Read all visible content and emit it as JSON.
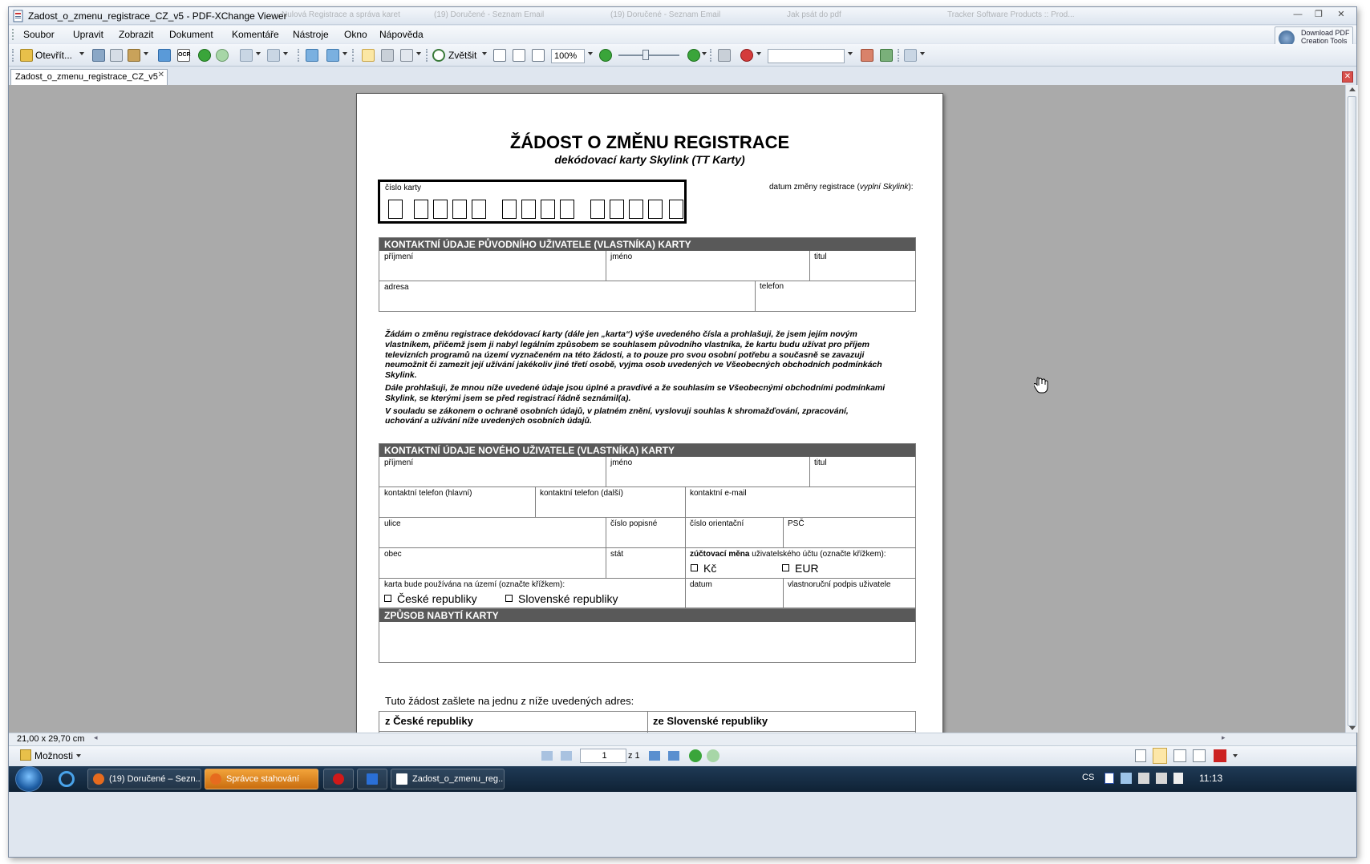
{
  "window": {
    "title": "Zadost_o_zmenu_registrace_CZ_v5 - PDF-XChange Viewer",
    "bg_tabs": [
      "Nulová Registrace a správa karet",
      "(19) Doručené - Seznam Email",
      "(19) Doručené - Seznam Email",
      "Jak psát do pdf",
      "Tracker Software Products :: Prod..."
    ]
  },
  "menu": [
    "Soubor",
    "Upravit",
    "Zobrazit",
    "Dokument",
    "Komentáře",
    "Nástroje",
    "Okno",
    "Nápověda"
  ],
  "download_pdf": {
    "line1": "Download PDF",
    "line2": "Creation Tools"
  },
  "toolbar": {
    "open_label": "Otevřít...",
    "zoom_in_label": "Zvětšit",
    "zoom_value": "100%",
    "ocr_label": "OCR",
    "search_value": ""
  },
  "tab": {
    "label": "Zadost_o_zmenu_registrace_CZ_v5"
  },
  "document": {
    "title": "ŽÁDOST O ZMĚNU REGISTRACE",
    "subtitle": "dekódovací karty Skylink (TT Karty)",
    "card_number_label": "číslo karty",
    "change_date_label_pre": "datum změny registrace (",
    "change_date_label_em": "vyplní Skylink",
    "change_date_label_post": "):",
    "section1": {
      "header": "KONTAKTNÍ ÚDAJE PŮVODNÍHO UŽIVATELE (VLASTNÍKA) KARTY",
      "surname": "příjmení",
      "name": "jméno",
      "title": "titul",
      "address": "adresa",
      "phone": "telefon"
    },
    "declaration": [
      "Žádám o změnu registrace dekódovací karty (dále jen „karta“) výše uvedeného čísla a prohlašuji, že jsem jejím novým",
      "vlastníkem, přičemž jsem ji nabyl legálním způsobem se souhlasem původního vlastníka, že kartu budu užívat pro příjem",
      "televizních programů na území vyznačeném na této žádosti, a to pouze pro svou osobní potřebu a současně se zavazuji",
      "neumožnit či zamezit její užívání jakékoliv jiné třetí osobě, vyjma osob uvedených ve Všeobecných obchodních podmínkách",
      "Skylink.",
      "Dále prohlašuji, že mnou níže uvedené údaje jsou úplné a pravdivé a že souhlasím se Všeobecnými obchodními podmínkami",
      "Skylink, se kterými jsem se před registrací řádně seznámil(a).",
      "V souladu se zákonem o ochraně osobních údajů, v platném znění, vyslovuji souhlas k shromažďování, zpracování,",
      "uchování a užívání níže uvedených osobních údajů."
    ],
    "section2": {
      "header": "KONTAKTNÍ ÚDAJE NOVÉHO UŽIVATELE (VLASTNÍKA) KARTY",
      "surname": "příjmení",
      "name": "jméno",
      "title": "titul",
      "phone_main": "kontaktní telefon (hlavní)",
      "phone_other": "kontaktní telefon (další)",
      "email": "kontaktní e-mail",
      "street": "ulice",
      "house_no": "číslo popisné",
      "orient_no": "číslo orientační",
      "zip": "PSČ",
      "city": "obec",
      "state": "stát",
      "currency_bold": "zúčtovací měna",
      "currency_rest": " uživatelského účtu (označte křížkem):",
      "currency_czk": "Kč",
      "currency_eur": "EUR",
      "territory_label": "karta bude používána na území (označte křížkem):",
      "territory_cz": "České republiky",
      "territory_sk": "Slovenské republiky",
      "date": "datum",
      "signature": "vlastnoruční podpis uživatele"
    },
    "section3": {
      "header": "ZPŮSOB NABYTÍ KARTY"
    },
    "send_to": "Tuto žádost zašlete na jednu z níže uvedených adres:",
    "from_cz": "z České republiky",
    "from_sk": "ze Slovenské republiky"
  },
  "status": {
    "page_size": "21,00 x 29,70 cm"
  },
  "nav": {
    "options_label": "Možnosti",
    "page_value": "1",
    "page_of": "z 1"
  },
  "taskbar": {
    "items": [
      "(19) Doručené – Sezn...",
      "Správce stahování",
      "",
      "",
      "Zadost_o_zmenu_reg..."
    ],
    "lang": "CS",
    "clock": "11:13"
  }
}
